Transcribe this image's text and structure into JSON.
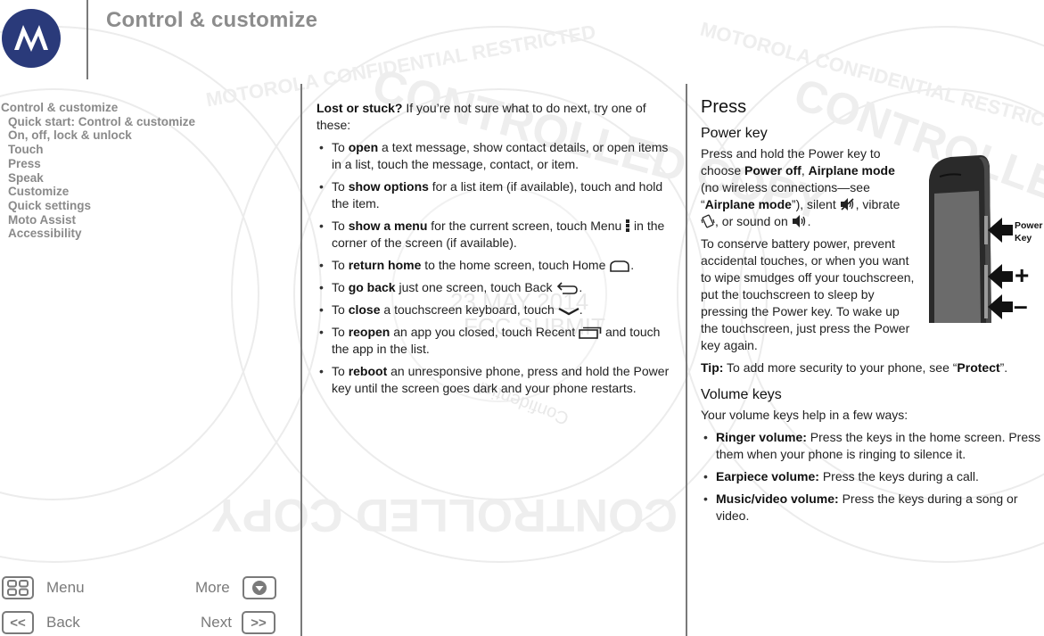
{
  "header": {
    "title": "Control & customize",
    "logo": "motorola-logo"
  },
  "toc": {
    "items": [
      {
        "label": "Control & customize",
        "level": 0
      },
      {
        "label": "Quick start: Control & customize",
        "level": 1
      },
      {
        "label": "On, off, lock & unlock",
        "level": 1
      },
      {
        "label": "Touch",
        "level": 1
      },
      {
        "label": "Press",
        "level": 1
      },
      {
        "label": "Speak",
        "level": 1
      },
      {
        "label": "Customize",
        "level": 1
      },
      {
        "label": "Quick settings",
        "level": 1
      },
      {
        "label": "Moto Assist",
        "level": 1
      },
      {
        "label": "Accessibility",
        "level": 1
      }
    ]
  },
  "nav": {
    "menu": {
      "label": "Menu",
      "icon": "grid-icon"
    },
    "more": {
      "label": "More",
      "icon": "down-arrow-icon"
    },
    "back": {
      "label": "Back",
      "icon": "double-left-icon",
      "glyph": "<<"
    },
    "next": {
      "label": "Next",
      "icon": "double-right-icon",
      "glyph": ">>"
    }
  },
  "middle": {
    "intro_bold": "Lost or stuck?",
    "intro_rest": " If you’re not sure what to do next, try one of these:",
    "bullets": [
      {
        "pre": "To ",
        "bold": "open",
        "post": " a text message, show contact details, or open items in a list, touch the message, contact, or item.",
        "icon": null,
        "tail": ""
      },
      {
        "pre": "To ",
        "bold": "show options",
        "post": " for a list item (if available), touch and hold the item.",
        "icon": null,
        "tail": ""
      },
      {
        "pre": "To ",
        "bold": "show a menu",
        "post": " for the current screen, touch Menu ",
        "icon": "menu-dots-icon",
        "tail": " in the corner of the screen (if available)."
      },
      {
        "pre": "To ",
        "bold": "return home",
        "post": " to the home screen, touch Home ",
        "icon": "home-icon",
        "tail": "."
      },
      {
        "pre": "To ",
        "bold": "go back",
        "post": " just one screen, touch Back ",
        "icon": "back-icon",
        "tail": "."
      },
      {
        "pre": "To ",
        "bold": "close",
        "post": " a touchscreen keyboard, touch ",
        "icon": "keyboard-close-icon",
        "tail": "."
      },
      {
        "pre": "To ",
        "bold": "reopen",
        "post": " an app you closed, touch Recent ",
        "icon": "recent-apps-icon",
        "tail": " and touch the app in the list."
      },
      {
        "pre": "To ",
        "bold": "reboot",
        "post": " an unresponsive phone, press and hold the Power key until the screen goes dark and your phone restarts.",
        "icon": null,
        "tail": ""
      }
    ]
  },
  "right": {
    "heading": "Press",
    "power": {
      "heading": "Power key",
      "p1": {
        "a": "Press and hold the Power key to choose ",
        "b1": "Power off",
        "c": ", ",
        "b2": "Airplane mode",
        "d": " (no wireless connections—see “",
        "b3": "Airplane mode",
        "e": "”), silent ",
        "f": ", vibrate ",
        "g": ", or sound on ",
        "h": "."
      },
      "p2": "To conserve battery power, prevent accidental touches, or when you want to wipe smudges off your touchscreen, put the touchscreen to sleep by pressing the Power key. To wake up the touchscreen, just press the Power key again.",
      "tip_bold": "Tip:",
      "tip_text": " To add more security to your phone, see “",
      "tip_link": "Protect",
      "tip_end": "”."
    },
    "figure": {
      "power_label_1": "Power",
      "power_label_2": "Key",
      "plus_label": "+",
      "minus_label": "–"
    },
    "volume": {
      "heading": "Volume keys",
      "intro": "Your volume keys help in a few ways:",
      "bullets": [
        {
          "bold": "Ringer volume:",
          "text": " Press the keys in the home screen. Press them when your phone is ringing to silence it."
        },
        {
          "bold": "Earpiece volume:",
          "text": " Press the keys during a call."
        },
        {
          "bold": "Music/video volume:",
          "text": " Press the keys during a song or video."
        }
      ]
    }
  },
  "watermark": {
    "lines": [
      "MOTOROLA CONFIDENTIAL RESTRICTED",
      "CONTROLLED COPY",
      "23 MAY 2014",
      "FCC SUBMIT",
      "Confidential"
    ]
  }
}
